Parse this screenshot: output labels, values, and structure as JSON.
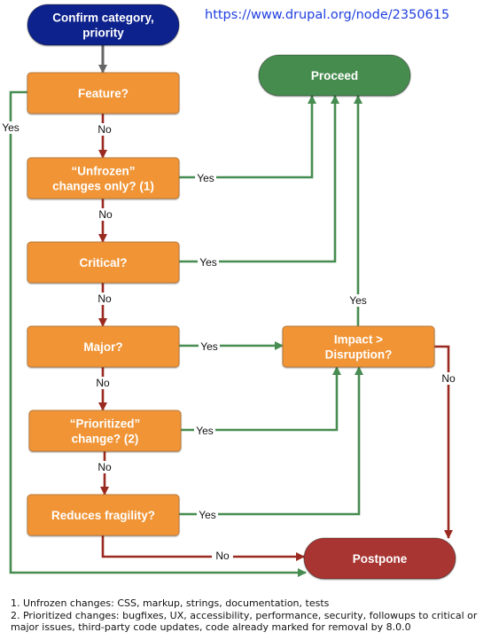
{
  "source_url": "https://www.drupal.org/node/2350615",
  "colors": {
    "start": "#10248c",
    "decision": "#f09435",
    "decision_border": "#b87a3e",
    "proceed": "#478c50",
    "postpone": "#a83530",
    "yes_edge": "#478c50",
    "no_edge": "#9a2a20",
    "start_edge": "#666666"
  },
  "nodes": {
    "start": {
      "lines": [
        "Confirm category,",
        "priority"
      ]
    },
    "feature": {
      "lines": [
        "Feature?"
      ]
    },
    "unfrozen": {
      "lines": [
        "“Unfrozen”",
        "changes only? (1)"
      ]
    },
    "critical": {
      "lines": [
        "Critical?"
      ]
    },
    "major": {
      "lines": [
        "Major?"
      ]
    },
    "prioritized": {
      "lines": [
        "“Prioritized”",
        "change? (2)"
      ]
    },
    "fragility": {
      "lines": [
        "Reduces fragility?"
      ]
    },
    "impact": {
      "lines": [
        "Impact >",
        "Disruption?"
      ]
    },
    "proceed": {
      "lines": [
        "Proceed"
      ]
    },
    "postpone": {
      "lines": [
        "Postpone"
      ]
    }
  },
  "edges": [
    {
      "id": "start-feature",
      "from": "start",
      "to": "feature",
      "label": "",
      "kind": "start"
    },
    {
      "id": "feature-unfrozen",
      "from": "feature",
      "to": "unfrozen",
      "label": "No",
      "kind": "no"
    },
    {
      "id": "unfrozen-critical",
      "from": "unfrozen",
      "to": "critical",
      "label": "No",
      "kind": "no"
    },
    {
      "id": "critical-major",
      "from": "critical",
      "to": "major",
      "label": "No",
      "kind": "no"
    },
    {
      "id": "major-prioritized",
      "from": "major",
      "to": "prioritized",
      "label": "No",
      "kind": "no"
    },
    {
      "id": "prioritized-fragility",
      "from": "prioritized",
      "to": "fragility",
      "label": "No",
      "kind": "no"
    },
    {
      "id": "fragility-postpone",
      "from": "fragility",
      "to": "postpone",
      "label": "No",
      "kind": "no"
    },
    {
      "id": "feature-postpone",
      "from": "feature",
      "to": "postpone",
      "label": "Yes",
      "kind": "yes"
    },
    {
      "id": "unfrozen-proceed",
      "from": "unfrozen",
      "to": "proceed",
      "label": "Yes",
      "kind": "yes"
    },
    {
      "id": "critical-proceed",
      "from": "critical",
      "to": "proceed",
      "label": "Yes",
      "kind": "yes"
    },
    {
      "id": "major-impact",
      "from": "major",
      "to": "impact",
      "label": "Yes",
      "kind": "yes"
    },
    {
      "id": "prioritized-impact",
      "from": "prioritized",
      "to": "impact",
      "label": "Yes",
      "kind": "yes"
    },
    {
      "id": "fragility-impact",
      "from": "fragility",
      "to": "impact",
      "label": "Yes",
      "kind": "yes"
    },
    {
      "id": "impact-proceed",
      "from": "impact",
      "to": "proceed",
      "label": "Yes",
      "kind": "yes"
    },
    {
      "id": "impact-postpone",
      "from": "impact",
      "to": "postpone",
      "label": "No",
      "kind": "no"
    }
  ],
  "footnotes": [
    "1. Unfrozen changes: CSS, markup, strings, documentation, tests",
    "2. Prioritized changes: bugfixes, UX, accessibility, performance, security, followups to critical or major issues, third-party code updates, code already marked for removal by 8.0.0"
  ]
}
